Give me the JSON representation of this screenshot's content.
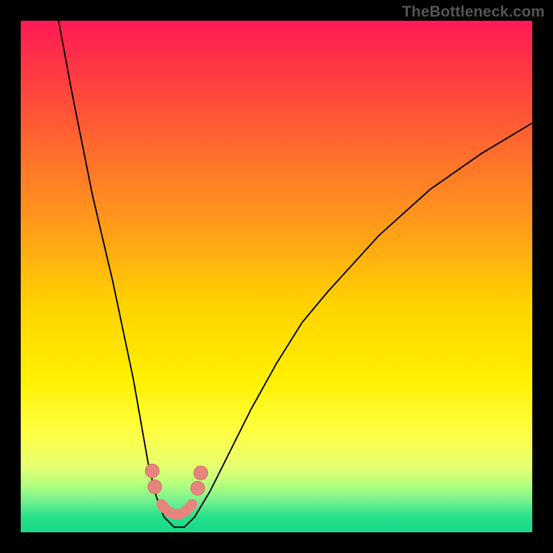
{
  "watermark": "TheBottleneck.com",
  "chart_data": {
    "type": "line",
    "title": "",
    "xlabel": "",
    "ylabel": "",
    "xlim": [
      0,
      100
    ],
    "ylim": [
      0,
      100
    ],
    "series": [
      {
        "name": "curve",
        "x": [
          7.4,
          10,
          14,
          18,
          22,
          25,
          26.5,
          28,
          30,
          32,
          34,
          37,
          40,
          45,
          50,
          55,
          60,
          70,
          80,
          90,
          100
        ],
        "values": [
          100,
          86,
          66,
          49,
          30,
          13,
          7,
          3,
          1,
          1,
          3,
          8,
          14,
          24,
          33,
          41,
          47,
          58,
          67,
          74,
          80
        ]
      }
    ],
    "markers": [
      {
        "name": "left-upper",
        "x": 25.7,
        "y": 12.0
      },
      {
        "name": "left-lower",
        "x": 26.2,
        "y": 8.9
      },
      {
        "name": "right-lower",
        "x": 34.6,
        "y": 8.6
      },
      {
        "name": "right-upper",
        "x": 35.2,
        "y": 11.6
      }
    ],
    "bottom_segment": {
      "x0": 27.5,
      "x1": 33.5,
      "y": 3.5
    },
    "colors": {
      "curve": "#000000",
      "marker": "#e6857e",
      "marker_stroke": "#d46a62"
    }
  }
}
